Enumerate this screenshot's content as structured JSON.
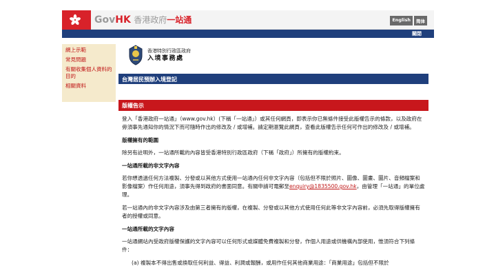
{
  "header": {
    "brand_gov": "Gov",
    "brand_hk": "HK",
    "brand_zh": "香港政府",
    "brand_zh_red": "一站通",
    "lang_english": "English",
    "lang_simplified": "简体",
    "nav_about": "關閉"
  },
  "sidebar": {
    "items": [
      {
        "label": "網上示範"
      },
      {
        "label": "常見問題"
      },
      {
        "label": "有關收集個人資料的目的"
      },
      {
        "label": "相關資料"
      }
    ]
  },
  "department": {
    "name_small": "香港特別行政區政府",
    "name_big": "入境事務處"
  },
  "main": {
    "title": "台灣居民預辦入境登記",
    "notice_heading": "版權告示",
    "intro": "登入「香港政府一站通」（www.gov.hk）(下稱「一站通」）或其任何網頁，即表示你已無條件接受此版權告示的條款，以及政府在毋須事先通知你的情況下而可隨時作出的修改及 / 或增補。請定期瀏覽此網頁，查看此版權告示任何可作出的修改及 / 或增補。",
    "section1_title": "版權擁有的範圍",
    "section1_text": "除另有註明外，一站通所載的內容皆受香港特別行政區政府（下稱「政府」）所擁有的版權約束。",
    "section2_title": "一站通所載的非文字內容",
    "section2_text_before": "若你想透過任何方法複製、分發或以其他方式使用一站通內任何非文字內容（包括但不限於照片、圖像、圖畫、圖片、音頻檔案和影像檔案）作任何用途，須事先得到政府的書面同意。有關申請可電郵至",
    "section2_email": "enquiry@1835500.gov.hk",
    "section2_text_after": "，由管理「一站通」的單位處理。",
    "section2_text2": "若一站通內的非文字內容涉及由第三者擁有的版權，在複製、分發或以其他方式使用任何此等非文字內容前，必須先取得版權擁有者的授權或同意。",
    "section3_title": "一站通所載的文字內容",
    "section3_text": "一站通網站內受政府版權保護的文字內容可以任何形式或媒體免費複製和分發，作個人用途或供機構內部使用，惟須符合下列條件：",
    "section3_item_a": "(a) 複製本不得出售或換取任何利益、得益、利潤或報酬，或用作任何其他商業用途：「商業用途」包括但不限於"
  },
  "colors": {
    "brand_red": "#d8222a",
    "nav_blue": "#1f3f7c",
    "notice_red": "#c8171c",
    "sidebar_bg": "#f5eacc",
    "link_red": "#c01717"
  }
}
